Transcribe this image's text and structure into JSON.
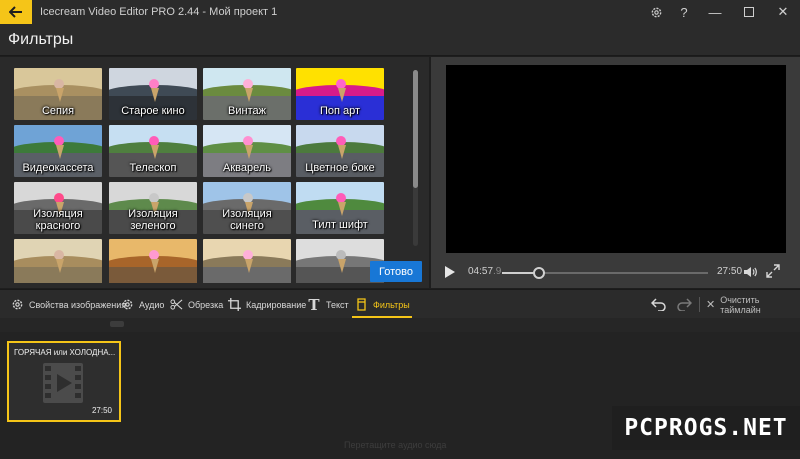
{
  "app": {
    "title": "Icecream Video Editor PRO 2.44 - Мой проект 1",
    "accent": "#f5c518"
  },
  "header": {
    "title": "Фильтры"
  },
  "filters": {
    "items": [
      {
        "label": "Сепия",
        "sky": "#d9c79a",
        "hill": "#a99061",
        "road": "#8a7a5a",
        "scoop": "#d9b6a3"
      },
      {
        "label": "Старое кино",
        "sky": "#cfd6df",
        "hill": "#3f4a55",
        "road": "#2d3238",
        "scoop": "#ff7fc7"
      },
      {
        "label": "Винтаж",
        "sky": "#cfe7f0",
        "hill": "#6b8b3f",
        "road": "#6b6f6a",
        "scoop": "#ffb0d8"
      },
      {
        "label": "Поп арт",
        "sky": "#ffe100",
        "hill": "#d81b8a",
        "road": "#2a2fd6",
        "scoop": "#ff66cc"
      },
      {
        "label": "Видеокассета",
        "sky": "#6fa3d6",
        "hill": "#3d7a3a",
        "road": "#5a5f66",
        "scoop": "#ff5cb8"
      },
      {
        "label": "Телескоп",
        "sky": "#c6dff2",
        "hill": "#4f7f3f",
        "road": "#555",
        "scoop": "#ff5cb8"
      },
      {
        "label": "Акварель",
        "sky": "#d6e6f4",
        "hill": "#5f8f45",
        "road": "#7d7d82",
        "scoop": "#ff8fd0"
      },
      {
        "label": "Цветное боке",
        "sky": "#c8d9ee",
        "hill": "#4c7a3d",
        "road": "#595d63",
        "scoop": "#ff5cb8"
      },
      {
        "label": "Изоляция красного",
        "sky": "#d8d8d8",
        "hill": "#6a6a6a",
        "road": "#4a4a4a",
        "scoop": "#ff4a8a"
      },
      {
        "label": "Изоляция зеленого",
        "sky": "#d8d8d8",
        "hill": "#5e8a4c",
        "road": "#4a4a4a",
        "scoop": "#c8c8c8"
      },
      {
        "label": "Изоляция синего",
        "sky": "#9fc4e8",
        "hill": "#6a6a6a",
        "road": "#4f4f4f",
        "scoop": "#c8c8c8"
      },
      {
        "label": "Тилт шифт",
        "sky": "#c0dcf2",
        "hill": "#4f8a3e",
        "road": "#5a5e64",
        "scoop": "#ff5cb8"
      },
      {
        "label": "",
        "sky": "#e0d4b4",
        "hill": "#a88d5e",
        "road": "#8a7a5a",
        "scoop": "#d9b6a3"
      },
      {
        "label": "",
        "sky": "#e8b86a",
        "hill": "#a8652a",
        "road": "#7a5a3a",
        "scoop": "#ff9ad0"
      },
      {
        "label": "",
        "sky": "#e8d6b0",
        "hill": "#8a7a5a",
        "road": "#6a6a6a",
        "scoop": "#ffb0d8"
      },
      {
        "label": "",
        "sky": "#dddddd",
        "hill": "#777777",
        "road": "#555555",
        "scoop": "#bbbbbb"
      }
    ],
    "done_label": "Готово"
  },
  "player": {
    "current_time": "04:57",
    "current_frame": ".9",
    "total_time": "27:50",
    "progress": 0.178
  },
  "toolbar": {
    "tools": [
      {
        "label": "Свойства изображения",
        "icon": "gear-icon"
      },
      {
        "label": "Аудио",
        "icon": "gear-icon"
      },
      {
        "label": "Обрезка",
        "icon": "scissors-icon"
      },
      {
        "label": "Кадрирование",
        "icon": "crop-icon"
      },
      {
        "label": "Текст",
        "icon": "text-icon"
      },
      {
        "label": "Фильтры",
        "icon": "filter-icon"
      }
    ],
    "clear_label": "Очистить таймлайн"
  },
  "timeline": {
    "clip": {
      "title": "ГОРЯЧАЯ или ХОЛОДНА...",
      "duration": "27:50"
    },
    "audio_hint": "Перетащите аудио сюда"
  },
  "watermark": {
    "text": "PCPROGS.NET"
  }
}
